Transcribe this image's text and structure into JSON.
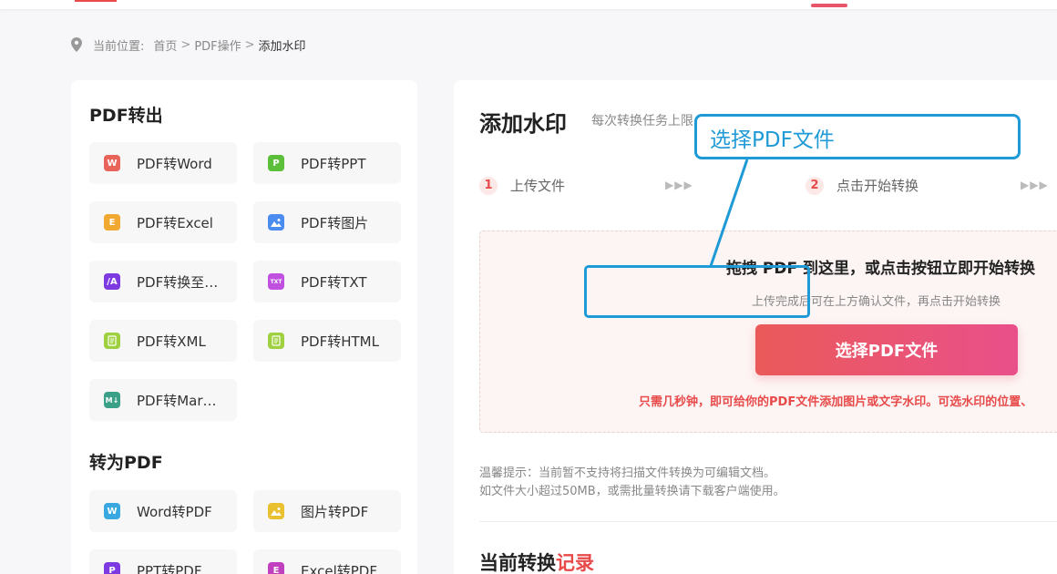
{
  "breadcrumb": {
    "label": "当前位置:",
    "home": "首页",
    "sep1": ">",
    "section": "PDF操作",
    "sep2": ">",
    "current": "添加水印"
  },
  "sidebar": {
    "export_title": "PDF转出",
    "export_items": [
      {
        "label": "PDF转Word",
        "icon": "word-icon",
        "icon_text": "W",
        "color": "#e8645a"
      },
      {
        "label": "PDF转PPT",
        "icon": "ppt-icon",
        "icon_text": "P",
        "color": "#5bbf3a"
      },
      {
        "label": "PDF转Excel",
        "icon": "excel-icon",
        "icon_text": "E",
        "color": "#f0a830"
      },
      {
        "label": "PDF转图片",
        "icon": "image-icon",
        "icon_text": "",
        "color": "#4a8cf0"
      },
      {
        "label": "PDF转换至…",
        "icon": "convert-icon",
        "icon_text": "/A",
        "color": "#7c3ae0"
      },
      {
        "label": "PDF转TXT",
        "icon": "txt-icon",
        "icon_text": "TXT",
        "color": "#c050e0"
      },
      {
        "label": "PDF转XML",
        "icon": "xml-icon",
        "icon_text": "",
        "color": "#9fd040"
      },
      {
        "label": "PDF转HTML",
        "icon": "html-icon",
        "icon_text": "",
        "color": "#9fd040"
      },
      {
        "label": "PDF转Mar…",
        "icon": "markdown-icon",
        "icon_text": "M↓",
        "color": "#3aa088"
      }
    ],
    "import_title": "转为PDF",
    "import_items": [
      {
        "label": "Word转PDF",
        "icon": "word-icon",
        "icon_text": "W",
        "color": "#3aa8e0"
      },
      {
        "label": "图片转PDF",
        "icon": "image-icon",
        "icon_text": "",
        "color": "#e8c030"
      },
      {
        "label": "PPT转PDF",
        "icon": "ppt-icon",
        "icon_text": "P",
        "color": "#7c3ae0"
      },
      {
        "label": "Excel转PDF",
        "icon": "excel-icon",
        "icon_text": "E",
        "color": "#c040c0"
      }
    ]
  },
  "main": {
    "title": "添加水印",
    "subtitle": "每次转换任务上限",
    "steps": [
      {
        "num": "1",
        "label": "上传文件"
      },
      {
        "num": "2",
        "label": "点击开始转换"
      }
    ],
    "step_arrows": "▶▶▶",
    "dropzone": {
      "title": "拖拽 PDF 到这里，或点击按钮立即开始转换",
      "subtitle": "上传完成后可在上方确认文件，再点击开始转换",
      "button": "选择PDF文件",
      "note": "只需几秒钟，即可给你的PDF文件添加图片或文字水印。可选水印的位置、"
    },
    "tip_line1": "温馨提示：当前暂不支持将扫描文件转换为可编辑文档。",
    "tip_line2": "如文件大小超过50MB，或需批量转换请下载客户端使用。",
    "records_title_prefix": "当前转换",
    "records_title_highlight": "记录"
  },
  "annotation": {
    "callout_text": "选择PDF文件",
    "color": "#1e9ad6"
  },
  "colors": {
    "accent": "#e84a4a",
    "button_gradient_start": "#ea5a5a",
    "button_gradient_end": "#e9508a",
    "annotation": "#1e9ad6"
  }
}
